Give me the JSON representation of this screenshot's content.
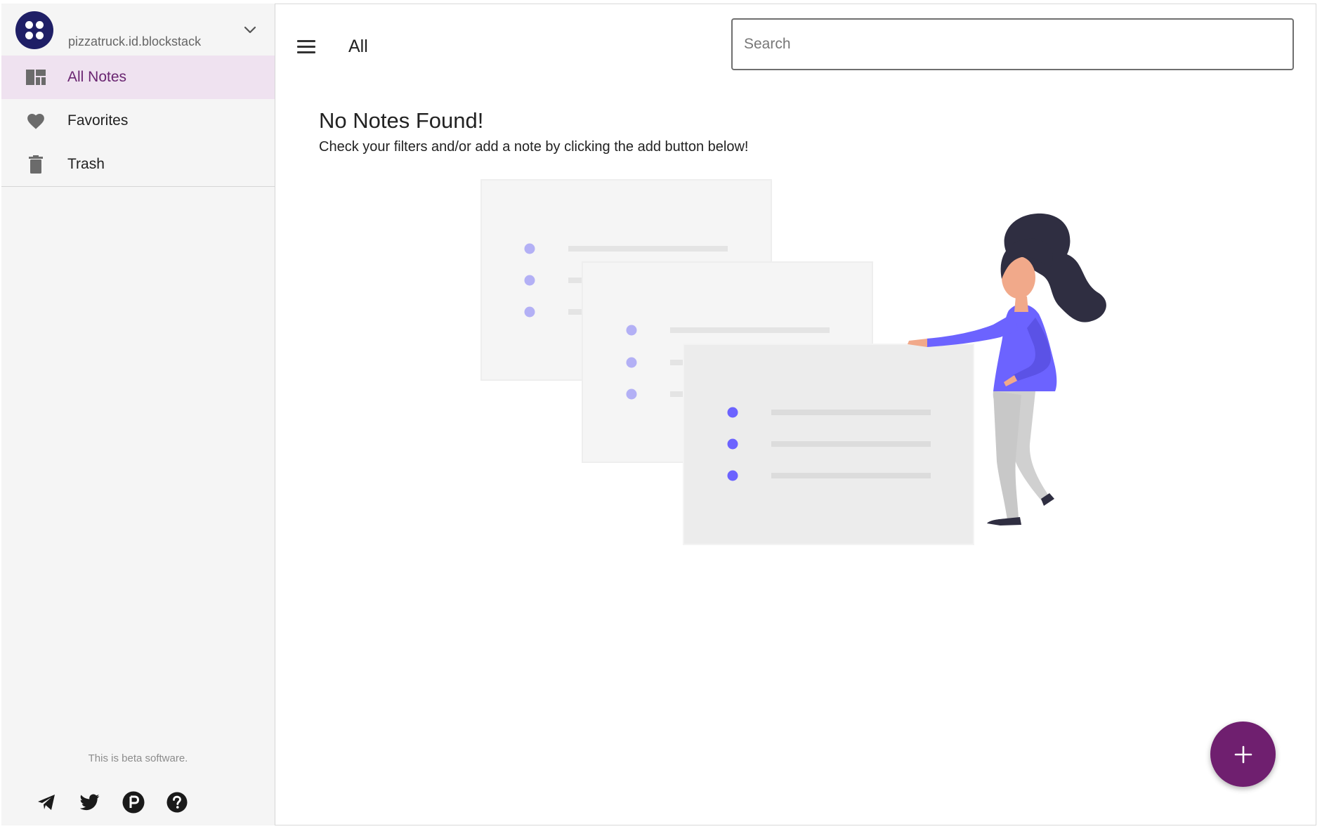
{
  "account": {
    "name": "pizzatruck.id.blockstack",
    "avatar_icon": "blockstack-icon"
  },
  "sidebar": {
    "items": [
      {
        "label": "All Notes",
        "icon": "dashboard-icon",
        "active": true
      },
      {
        "label": "Favorites",
        "icon": "heart-icon",
        "active": false
      },
      {
        "label": "Trash",
        "icon": "trash-icon",
        "active": false
      }
    ],
    "beta_text": "This is beta software.",
    "social": [
      "telegram-icon",
      "twitter-icon",
      "producthunt-icon",
      "help-icon"
    ]
  },
  "header": {
    "title": "All",
    "search_placeholder": "Search"
  },
  "empty_state": {
    "title": "No Notes Found!",
    "subtitle": "Check your filters and/or add a note by clicking the add button below!"
  },
  "fab": {
    "icon": "plus-icon"
  },
  "colors": {
    "accent": "#6f1f6f",
    "active_bg": "#efe2f0",
    "avatar_bg": "#1f1f66",
    "illustration_primary": "#6c63ff"
  }
}
